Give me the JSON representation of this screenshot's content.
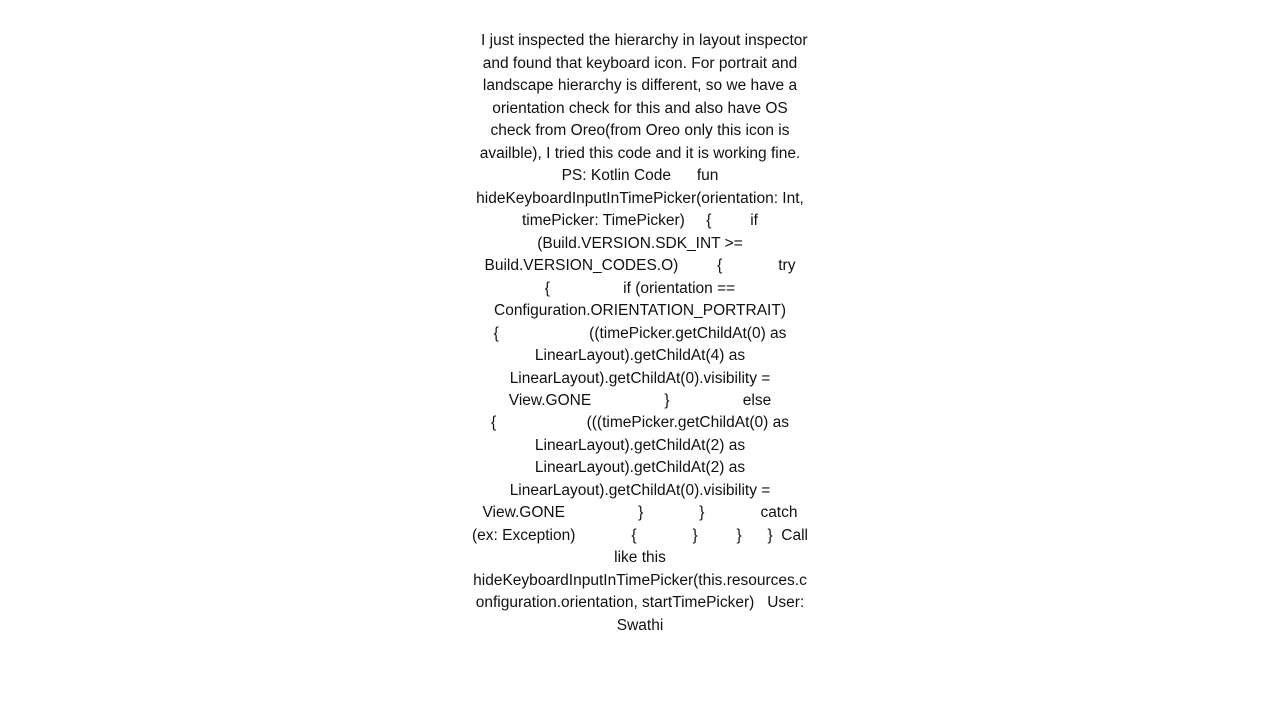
{
  "post": {
    "body": "I just inspected the hierarchy in layout inspector and found that keyboard icon. For portrait and landscape hierarchy is different, so we have a orientation check for this and also have OS check from Oreo(from Oreo only this icon is availble), I tried this code and it is working fine.  PS: Kotlin Code      fun hideKeyboardInputInTimePicker(orientation: Int, timePicker: TimePicker)     {         if (Build.VERSION.SDK_INT >= Build.VERSION_CODES.O)         {             try             {                 if (orientation == Configuration.ORIENTATION_PORTRAIT)                 {                     ((timePicker.getChildAt(0) as LinearLayout).getChildAt(4) as LinearLayout).getChildAt(0).visibility = View.GONE                 }                 else                 {                     (((timePicker.getChildAt(0) as LinearLayout).getChildAt(2) as LinearLayout).getChildAt(2) as LinearLayout).getChildAt(0).visibility = View.GONE                 }             }             catch (ex: Exception)             {             }         }      }  Call like this hideKeyboardInputInTimePicker(this.resources.configuration.orientation, startTimePicker)   User: Swathi"
  }
}
